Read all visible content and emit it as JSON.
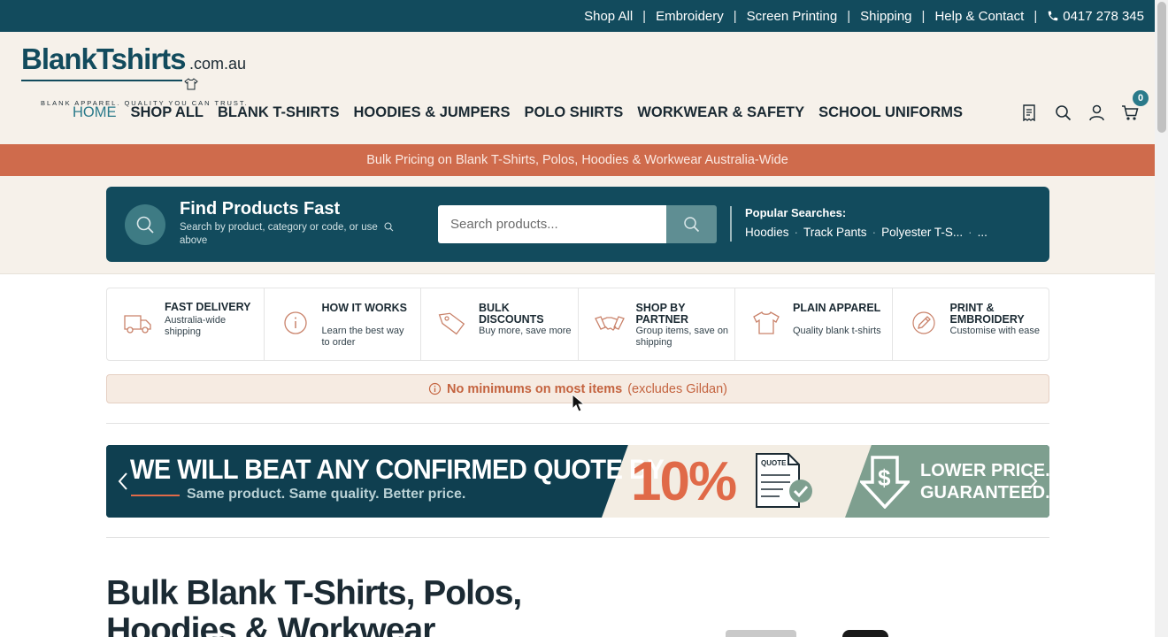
{
  "topbar": {
    "links": [
      "Shop All",
      "Embroidery",
      "Screen Printing",
      "Shipping",
      "Help & Contact"
    ],
    "separator": "|",
    "phone": "0417 278 345"
  },
  "logo": {
    "brand": "BlankTshirts",
    "domain": ".com.au",
    "tagline": "BLANK APPAREL. QUALITY YOU CAN TRUST."
  },
  "nav": [
    "HOME",
    "SHOP ALL",
    "BLANK T-SHIRTS",
    "HOODIES & JUMPERS",
    "POLO SHIRTS",
    "WORKWEAR & SAFETY",
    "SCHOOL UNIFORMS"
  ],
  "header_icons": [
    "receipt-icon",
    "search-icon",
    "user-icon",
    "cart-icon"
  ],
  "cart_count": "0",
  "announcement": "Bulk Pricing on Blank T-Shirts, Polos, Hoodies & Workwear Australia-Wide",
  "search": {
    "title": "Find Products Fast",
    "subtitle": "Search by product, category or code, or use",
    "subtitle_tail": "above",
    "placeholder": "Search products...",
    "popular_title": "Popular Searches:",
    "popular": [
      "Hoodies",
      "Track Pants",
      "Polyester T-S...",
      "..."
    ],
    "popular_sep": "·"
  },
  "features": [
    {
      "title": "FAST DELIVERY",
      "desc": "Australia-wide shipping",
      "icon": "truck-icon"
    },
    {
      "title": "HOW IT WORKS",
      "desc": "Learn the best way to order",
      "icon": "info-icon"
    },
    {
      "title": "BULK DISCOUNTS",
      "desc": "Buy more, save more",
      "icon": "tag-icon"
    },
    {
      "title": "SHOP BY PARTNER",
      "desc": "Group items, save on shipping",
      "icon": "handshake-icon"
    },
    {
      "title": "PLAIN APPAREL",
      "desc": "Quality blank t-shirts",
      "icon": "tshirt-icon"
    },
    {
      "title": "PRINT & EMBROIDERY",
      "desc": "Customise with ease",
      "icon": "pen-icon"
    }
  ],
  "notice": {
    "strong": "No minimums on most items",
    "rest": "(excludes Gildan)"
  },
  "banner": {
    "headline": "WE WILL BEAT ANY CONFIRMED QUOTE BY",
    "subline": "Same product. Same quality. Better price.",
    "percent": "10%",
    "quote_label": "QUOTE",
    "lower_line1": "LOWER PRICE.",
    "lower_line2": "GUARANTEED."
  },
  "hero": {
    "title": "Bulk Blank T-Shirts, Polos, Hoodies & Workwear"
  },
  "colors": {
    "teal_dark": "#124b5d",
    "accent_orange": "#cf6b4c",
    "cream": "#f6f1ea",
    "teal_light": "#2a7a8a"
  }
}
